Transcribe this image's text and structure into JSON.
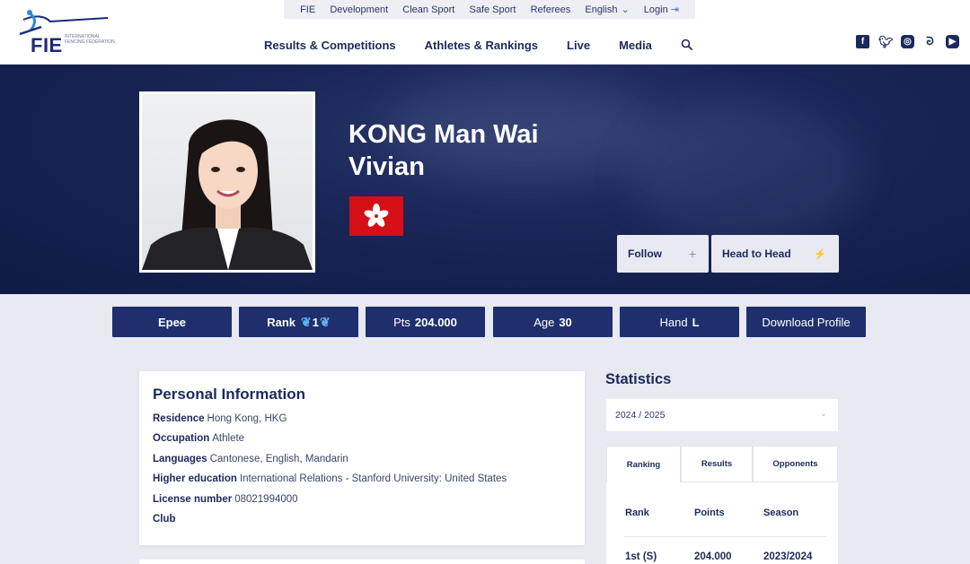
{
  "logo": {
    "text": "FIE",
    "subtitle": "INTERNATIONAL FENCING FEDERATION"
  },
  "topbar": {
    "items": [
      "FIE",
      "Development",
      "Clean Sport",
      "Safe Sport",
      "Referees"
    ],
    "language": "English",
    "login": "Login"
  },
  "nav": {
    "items": [
      "Results & Competitions",
      "Athletes & Rankings",
      "Live",
      "Media"
    ]
  },
  "social": [
    "facebook-icon",
    "twitter-icon",
    "instagram-icon",
    "weibo-icon",
    "youtube-icon"
  ],
  "athlete": {
    "name": "KONG Man Wai Vivian",
    "flag_color": "#d50f16"
  },
  "actions": {
    "follow": "Follow",
    "follow_icon": "+",
    "head_to_head": "Head to Head",
    "h2h_icon": "⚡"
  },
  "stats_bar": {
    "weapon": "Epee",
    "rank_label": "Rank",
    "rank_value": "1",
    "pts_label": "Pts",
    "pts_value": "204.000",
    "age_label": "Age",
    "age_value": "30",
    "hand_label": "Hand",
    "hand_value": "L",
    "download": "Download Profile"
  },
  "personal": {
    "title": "Personal Information",
    "rows": [
      {
        "key": "Residence",
        "value": "Hong Kong, HKG"
      },
      {
        "key": "Occupation",
        "value": "Athlete"
      },
      {
        "key": "Languages",
        "value": "Cantonese, English, Mandarin"
      },
      {
        "key": "Higher education",
        "value": "International Relations - Stanford University: United States"
      },
      {
        "key": "License number",
        "value": "08021994000"
      },
      {
        "key": "Club",
        "value": ""
      }
    ]
  },
  "statistics": {
    "title": "Statistics",
    "season": "2024 / 2025",
    "tabs": [
      "Ranking",
      "Results",
      "Opponents"
    ],
    "columns": [
      "Rank",
      "Points",
      "Season"
    ],
    "rows": [
      {
        "rank": "1st (S)",
        "points": "204.000",
        "season": "2023/2024"
      }
    ]
  },
  "colors": {
    "navy": "#1f2f6e",
    "hero": "#1a2657",
    "accent": "#3b6fd8"
  }
}
